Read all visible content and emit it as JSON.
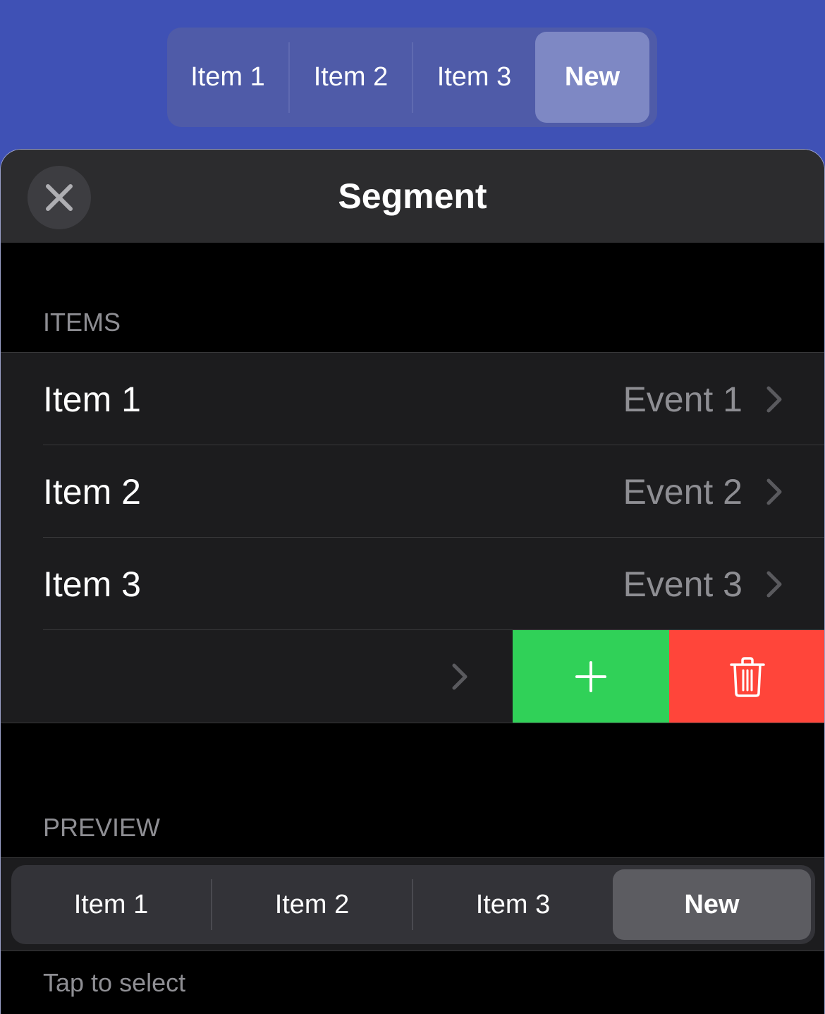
{
  "top_segmented": {
    "items": [
      "Item 1",
      "Item 2",
      "Item 3",
      "New"
    ],
    "selected": "New"
  },
  "sheet": {
    "title": "Segment",
    "close_icon": "close-icon"
  },
  "items_section": {
    "header": "ITEMS",
    "rows": [
      {
        "label": "Item 1",
        "value": "Event 1"
      },
      {
        "label": "Item 2",
        "value": "Event 2"
      },
      {
        "label": "Item 3",
        "value": "Event 3"
      }
    ],
    "swipe_row": {
      "label": "",
      "actions": [
        {
          "name": "add",
          "icon": "plus-icon",
          "color": "#30d158"
        },
        {
          "name": "delete",
          "icon": "trash-icon",
          "color": "#ff453a"
        }
      ]
    }
  },
  "preview_section": {
    "header": "PREVIEW",
    "segmented": {
      "items": [
        "Item 1",
        "Item 2",
        "Item 3",
        "New"
      ],
      "selected": "New"
    },
    "footer": "Tap to select"
  },
  "colors": {
    "background_accent": "#3f51b5",
    "add_action": "#30d158",
    "delete_action": "#ff453a"
  }
}
